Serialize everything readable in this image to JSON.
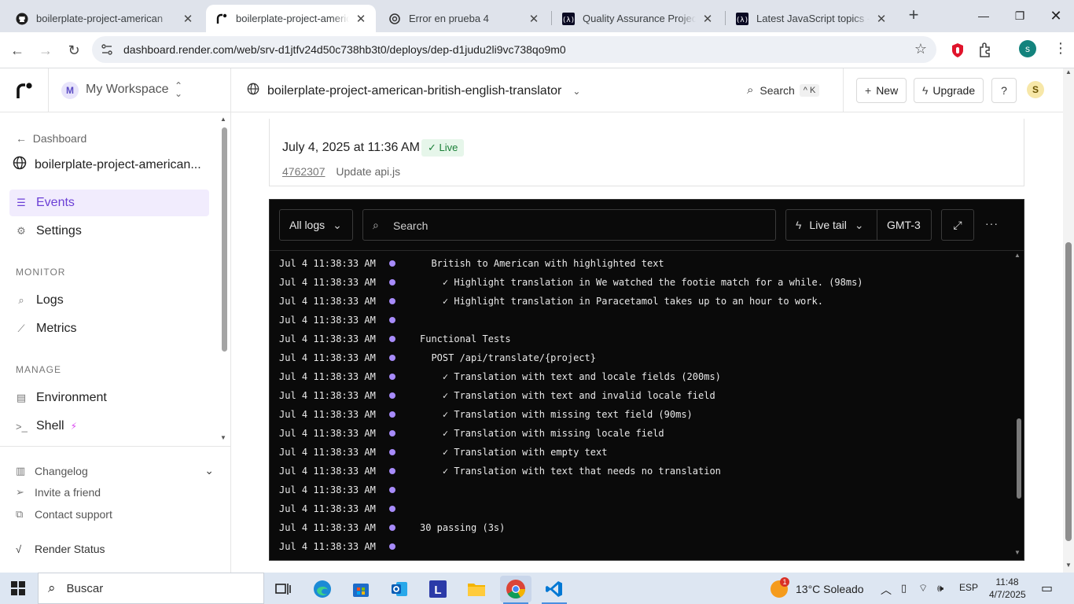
{
  "browser": {
    "tabs": [
      {
        "title": "boilerplate-project-american",
        "icon": "github-icon"
      },
      {
        "title": "boilerplate-project-american",
        "icon": "render-icon",
        "active": true
      },
      {
        "title": "Error en prueba 4",
        "icon": "openai-icon"
      },
      {
        "title": "Quality Assurance Projects -",
        "icon": "freecodecamp-icon"
      },
      {
        "title": "Latest JavaScript topics - The",
        "icon": "freecodecamp-icon"
      }
    ],
    "url": "dashboard.render.com/web/srv-d1jtfv24d50c738hb3t0/deploys/dep-d1judu2li9vc738qo9m0",
    "profile_initial": "s"
  },
  "sidebar": {
    "workspace_initial": "M",
    "workspace_name": "My Workspace",
    "back_link": "Dashboard",
    "service_name": "boilerplate-project-american...",
    "nav": [
      {
        "label": "Events",
        "icon": "list-icon",
        "active": true
      },
      {
        "label": "Settings",
        "icon": "gear-icon"
      }
    ],
    "monitor_heading": "MONITOR",
    "monitor": [
      {
        "label": "Logs",
        "icon": "logs-icon"
      },
      {
        "label": "Metrics",
        "icon": "chart-icon"
      }
    ],
    "manage_heading": "MANAGE",
    "manage": [
      {
        "label": "Environment",
        "icon": "env-icon"
      },
      {
        "label": "Shell",
        "icon": "terminal-icon"
      }
    ],
    "footer": [
      {
        "label": "Changelog",
        "icon": "changelog-icon"
      },
      {
        "label": "Invite a friend",
        "icon": "send-icon"
      },
      {
        "label": "Contact support",
        "icon": "external-icon"
      },
      {
        "label": "Render Status",
        "icon": "pulse-icon"
      }
    ]
  },
  "header": {
    "service_title": "boilerplate-project-american-british-english-translator",
    "search_label": "Search",
    "search_shortcut": "^ K",
    "new_label": "New",
    "upgrade_label": "Upgrade",
    "help_label": "?",
    "user_initial": "S"
  },
  "deploy": {
    "date": "July 4, 2025 at 11:36 AM",
    "status": "Live",
    "commit_hash": "4762307",
    "commit_message": "Update api.js"
  },
  "logs": {
    "filter_label": "All logs",
    "search_placeholder": "Search",
    "live_tail_label": "Live tail",
    "timezone": "GMT-3",
    "more_label": "···",
    "lines": [
      {
        "ts": "Jul 4 11:38:33 AM",
        "msg": "  British to American with highlighted text"
      },
      {
        "ts": "Jul 4 11:38:33 AM",
        "msg": "    ✓ Highlight translation in We watched the footie match for a while. (98ms)"
      },
      {
        "ts": "Jul 4 11:38:33 AM",
        "msg": "    ✓ Highlight translation in Paracetamol takes up to an hour to work."
      },
      {
        "ts": "Jul 4 11:38:33 AM",
        "msg": ""
      },
      {
        "ts": "Jul 4 11:38:33 AM",
        "msg": "Functional Tests"
      },
      {
        "ts": "Jul 4 11:38:33 AM",
        "msg": "  POST /api/translate/{project}"
      },
      {
        "ts": "Jul 4 11:38:33 AM",
        "msg": "    ✓ Translation with text and locale fields (200ms)"
      },
      {
        "ts": "Jul 4 11:38:33 AM",
        "msg": "    ✓ Translation with text and invalid locale field"
      },
      {
        "ts": "Jul 4 11:38:33 AM",
        "msg": "    ✓ Translation with missing text field (90ms)"
      },
      {
        "ts": "Jul 4 11:38:33 AM",
        "msg": "    ✓ Translation with missing locale field"
      },
      {
        "ts": "Jul 4 11:38:33 AM",
        "msg": "    ✓ Translation with empty text"
      },
      {
        "ts": "Jul 4 11:38:33 AM",
        "msg": "    ✓ Translation with text that needs no translation"
      },
      {
        "ts": "Jul 4 11:38:33 AM",
        "msg": ""
      },
      {
        "ts": "Jul 4 11:38:33 AM",
        "msg": ""
      },
      {
        "ts": "Jul 4 11:38:33 AM",
        "msg": "30 passing (3s)"
      },
      {
        "ts": "Jul 4 11:38:33 AM",
        "msg": ""
      }
    ]
  },
  "taskbar": {
    "search_label": "Buscar",
    "weather_badge": "1",
    "weather": "13°C  Soleado",
    "language": "ESP",
    "time": "11:48",
    "date": "4/7/2025"
  },
  "colors": {
    "accent": "#6b3fd6",
    "live_green": "#1a7f37",
    "log_bg": "#0a0a0a",
    "log_dot": "#a78bfa"
  }
}
